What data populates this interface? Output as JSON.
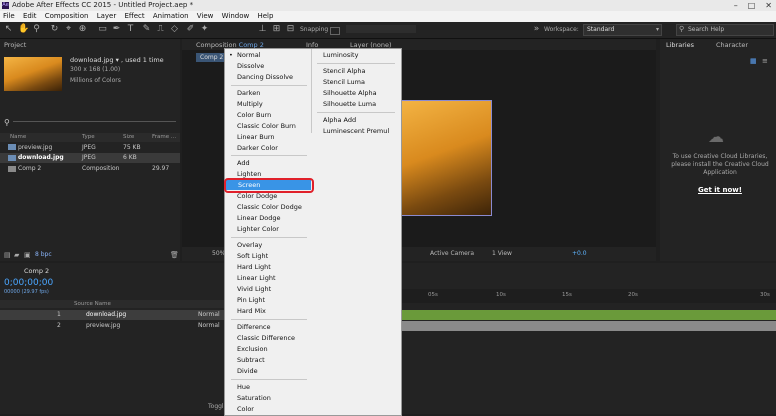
{
  "window": {
    "title": "Adobe After Effects CC 2015 - Untitled Project.aep *",
    "app_badge": "Ae"
  },
  "menubar": [
    "File",
    "Edit",
    "Composition",
    "Layer",
    "Effect",
    "Animation",
    "View",
    "Window",
    "Help"
  ],
  "toolbar": {
    "snapping": "Snapping",
    "workspace_label": "Workspace:",
    "workspace_value": "Standard",
    "search_placeholder": "Search Help"
  },
  "project": {
    "tab": "Project",
    "selected_name": "download.jpg ▾ , used 1 time",
    "selected_dims": "300 x 168 (1.00)",
    "selected_color": "Millions of Colors",
    "search_icon": "search-icon",
    "columns": [
      "Name",
      "Type",
      "Size",
      "Frame ..."
    ],
    "items": [
      {
        "name": "preview.jpg",
        "type": "JPEG",
        "size": "75 KB",
        "frame": ""
      },
      {
        "name": "download.jpg",
        "type": "JPEG",
        "size": "6 KB",
        "frame": ""
      },
      {
        "name": "Comp 2",
        "type": "Composition",
        "size": "",
        "frame": "29.97"
      }
    ],
    "bpc": "8 bpc"
  },
  "composition": {
    "tab": "Composition",
    "tab_name": "Comp 2",
    "comp_tag": "Comp 2",
    "zoom": "50%",
    "camera": "Active Camera",
    "view": "1 View",
    "exposure": "+0.0"
  },
  "other_tabs": {
    "info": "Info",
    "layer": "Layer (none)"
  },
  "libraries": {
    "tab1": "Libraries",
    "tab2": "Character",
    "message": "To use Creative Cloud Libraries, please install the Creative Cloud Application",
    "cta": "Get it now!"
  },
  "timeline": {
    "comp_tab": "Comp 2",
    "timecode": "0;00;00;00",
    "fps": "00000 (29.97 fps)",
    "columns": {
      "source_name": "Source Name",
      "mode": "Mode"
    },
    "layers": [
      {
        "index": "1",
        "name": "download.jpg",
        "mode": "Normal"
      },
      {
        "index": "2",
        "name": "preview.jpg",
        "mode": "Normal"
      }
    ],
    "ruler": [
      "05s",
      "10s",
      "15s",
      "20s",
      "30s"
    ],
    "toggle": "Toggle Switches / Modes"
  },
  "blend_menu": {
    "left": [
      [
        "Normal",
        "Dissolve",
        "Dancing Dissolve"
      ],
      [
        "Darken",
        "Multiply",
        "Color Burn",
        "Classic Color Burn",
        "Linear Burn",
        "Darker Color"
      ],
      [
        "Add",
        "Lighten",
        "Screen",
        "Color Dodge",
        "Classic Color Dodge",
        "Linear Dodge",
        "Lighter Color"
      ],
      [
        "Overlay",
        "Soft Light",
        "Hard Light",
        "Linear Light",
        "Vivid Light",
        "Pin Light",
        "Hard Mix"
      ],
      [
        "Difference",
        "Classic Difference",
        "Exclusion",
        "Subtract",
        "Divide"
      ],
      [
        "Hue",
        "Saturation",
        "Color",
        "Luminosity"
      ]
    ],
    "right": [
      [
        "Luminosity"
      ],
      [
        "Stencil Alpha",
        "Stencil Luma",
        "Silhouette Alpha",
        "Silhouette Luma"
      ],
      [
        "Alpha Add",
        "Luminescent Premul"
      ]
    ],
    "checked": "Normal",
    "highlighted": "Screen"
  }
}
